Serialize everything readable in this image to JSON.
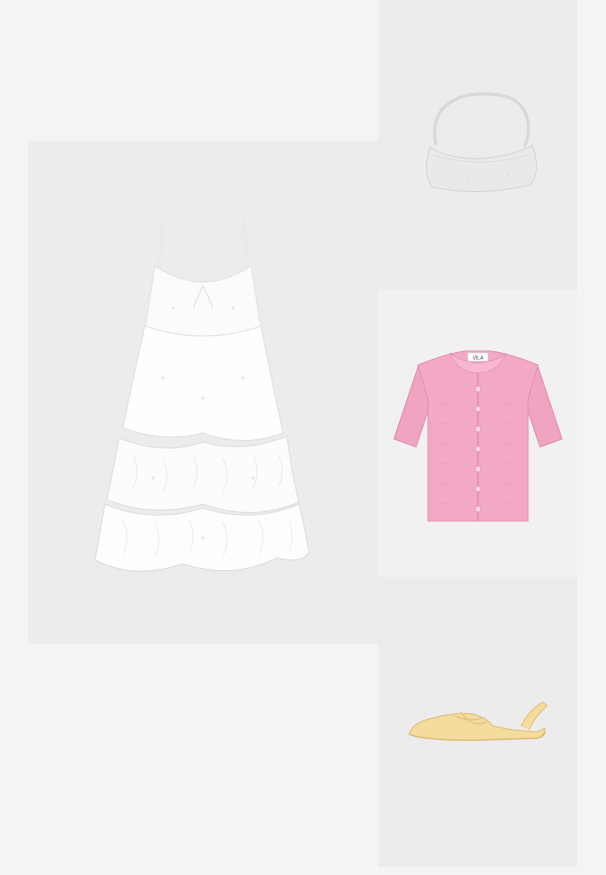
{
  "board": {
    "items": [
      {
        "id": "dress",
        "icon": "white-tiered-ruffle-mini-dress"
      },
      {
        "id": "bag",
        "icon": "white-beaded-shoulder-bag"
      },
      {
        "id": "cardigan",
        "icon": "pink-knit-short-sleeve-cardigan",
        "tag_text": "VILA"
      },
      {
        "id": "shoe",
        "icon": "yellow-slingback-flat"
      }
    ]
  }
}
